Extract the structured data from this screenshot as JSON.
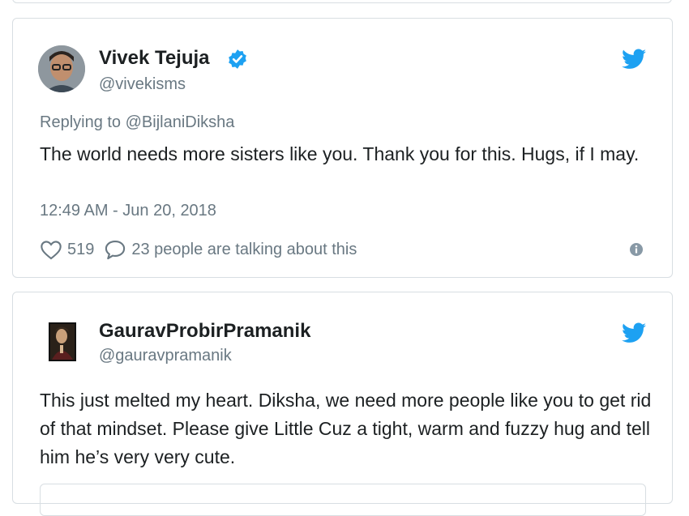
{
  "tweets": [
    {
      "author": "Vivek Tejuja",
      "handle": "@vivekisms",
      "verified": true,
      "replying_to": "Replying to @BijlaniDiksha",
      "text": "The world needs more sisters like you. Thank you for this. Hugs, if I may.",
      "timestamp": "12:49 AM - Jun 20, 2018",
      "likes": "519",
      "talking": "23 people are talking about this",
      "icons": [
        "twitter-bird-icon",
        "verified-icon",
        "heart-icon",
        "comment-icon",
        "info-icon"
      ]
    },
    {
      "author": "GauravProbirPramanik",
      "handle": "@gauravpramanik",
      "verified": false,
      "text": "This just melted my heart. Diksha, we need more people like you to get rid of that mindset. Please give Little Cuz a tight, warm and fuzzy hug and tell him he’s very very cute.",
      "icons": [
        "twitter-bird-icon"
      ]
    }
  ],
  "colors": {
    "twitter_blue": "#1da1f2",
    "text": "#1c2022",
    "muted": "#697882",
    "border": "#d8dee2"
  }
}
